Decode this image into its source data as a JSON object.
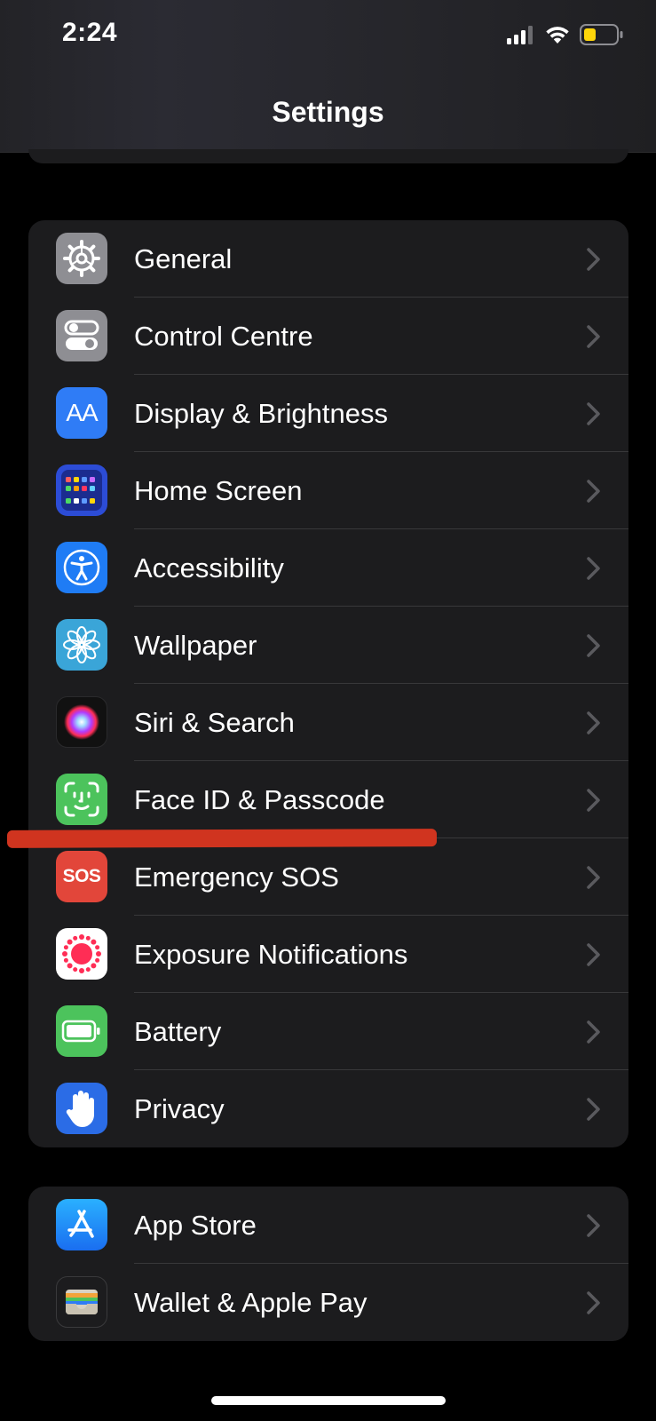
{
  "status_bar": {
    "time": "2:24"
  },
  "nav": {
    "title": "Settings"
  },
  "groups": [
    {
      "items": [
        {
          "label": "General",
          "icon": "gear-icon",
          "color": "#8e8e93"
        },
        {
          "label": "Control Centre",
          "icon": "toggles-icon",
          "color": "#8e8e93"
        },
        {
          "label": "Display & Brightness",
          "icon": "text-size-icon",
          "glyph": "AA",
          "color": "#2f7cf6"
        },
        {
          "label": "Home Screen",
          "icon": "home-screen-grid-icon",
          "color": "#2c4cd6"
        },
        {
          "label": "Accessibility",
          "icon": "accessibility-icon",
          "color": "#1f7cf5"
        },
        {
          "label": "Wallpaper",
          "icon": "flower-icon",
          "color": "#3aa5d8"
        },
        {
          "label": "Siri & Search",
          "icon": "siri-icon",
          "color": "#111111"
        },
        {
          "label": "Face ID & Passcode",
          "icon": "face-id-icon",
          "color": "#4cc35c"
        },
        {
          "label": "Emergency SOS",
          "icon": "sos-icon",
          "glyph": "SOS",
          "color": "#e2463a"
        },
        {
          "label": "Exposure Notifications",
          "icon": "exposure-icon",
          "color": "#ffffff"
        },
        {
          "label": "Battery",
          "icon": "battery-icon",
          "color": "#4cc35c"
        },
        {
          "label": "Privacy",
          "icon": "hand-icon",
          "color": "#2b6ce6"
        }
      ]
    },
    {
      "items": [
        {
          "label": "App Store",
          "icon": "app-store-icon",
          "color": "#1a8cf5"
        },
        {
          "label": "Wallet & Apple Pay",
          "icon": "wallet-icon",
          "color": "#1c1c1e"
        }
      ]
    }
  ],
  "colors": {
    "accent_redline": "#d0341f",
    "group_bg": "#1c1c1e",
    "separator": "#38383a",
    "chevron": "#5a5a5e"
  }
}
